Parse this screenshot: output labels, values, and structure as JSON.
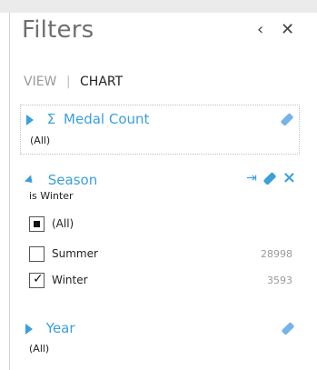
{
  "panel": {
    "title": "Filters",
    "collapse_glyph": "‹",
    "close_glyph": "✕"
  },
  "tabs": {
    "view": "VIEW",
    "separator": "|",
    "chart": "CHART"
  },
  "filters": [
    {
      "name": "Medal Count",
      "prefix": "Σ",
      "expanded": false,
      "summary": "(All)"
    },
    {
      "name": "Season",
      "expanded": true,
      "summary": "is Winter",
      "items": [
        {
          "label": "(All)",
          "state": "partial",
          "count": ""
        },
        {
          "label": "Summer",
          "state": "unchecked",
          "count": "28998"
        },
        {
          "label": "Winter",
          "state": "checked",
          "count": "3593"
        }
      ]
    },
    {
      "name": "Year",
      "expanded": false,
      "summary": "(All)"
    }
  ],
  "icons": {
    "expand": "expand-triangle-icon",
    "collapse": "collapse-triangle-icon",
    "sigma": "sigma-icon",
    "clear": "eraser-icon",
    "advanced": "advanced-filter-icon",
    "delete": "delete-x-icon"
  },
  "colors": {
    "accent": "#3aa0dc",
    "title_gray": "#6f6f6f",
    "count_gray": "#9a9a9a"
  }
}
